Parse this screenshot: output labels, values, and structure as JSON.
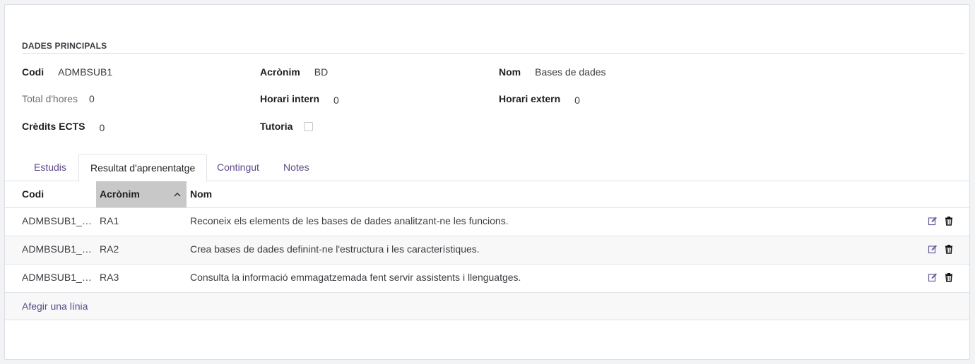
{
  "section": {
    "title": "DADES PRINCIPALS"
  },
  "fields": {
    "codi": {
      "label": "Codi",
      "value": "ADMBSUB1"
    },
    "acronim": {
      "label": "Acrònim",
      "value": "BD"
    },
    "nom": {
      "label": "Nom",
      "value": "Bases de dades"
    },
    "total_hores": {
      "label": "Total d'hores",
      "value": "0"
    },
    "horari_intern": {
      "label": "Horari intern",
      "value": "0"
    },
    "horari_extern": {
      "label": "Horari extern",
      "value": "0"
    },
    "credits_ects": {
      "label": "Crèdits ECTS",
      "value": "0"
    },
    "tutoria": {
      "label": "Tutoria",
      "checked": false
    }
  },
  "tabs": [
    {
      "label": "Estudis",
      "active": false
    },
    {
      "label": "Resultat d'aprenentatge",
      "active": true
    },
    {
      "label": "Contingut",
      "active": false
    },
    {
      "label": "Notes",
      "active": false
    }
  ],
  "table": {
    "columns": {
      "codi": "Codi",
      "acronim": "Acrònim",
      "nom": "Nom"
    },
    "sorted_column": "acronim",
    "sort_direction": "ascending",
    "rows": [
      {
        "codi": "ADMBSUB1_R…",
        "acronim": "RA1",
        "nom": "Reconeix els elements de les bases de dades analitzant-ne les funcions."
      },
      {
        "codi": "ADMBSUB1_R…",
        "acronim": "RA2",
        "nom": "Crea bases de dades definint-ne l'estructura i les característiques."
      },
      {
        "codi": "ADMBSUB1_R…",
        "acronim": "RA3",
        "nom": "Consulta la informació emmagatzemada fent servir assistents i llenguatges."
      }
    ],
    "add_line": "Afegir una línia",
    "row_actions": [
      "edit-icon",
      "trash-icon"
    ]
  },
  "colors": {
    "accent": "#5c4a87",
    "sorted_header_bg": "#c8c8c8"
  }
}
